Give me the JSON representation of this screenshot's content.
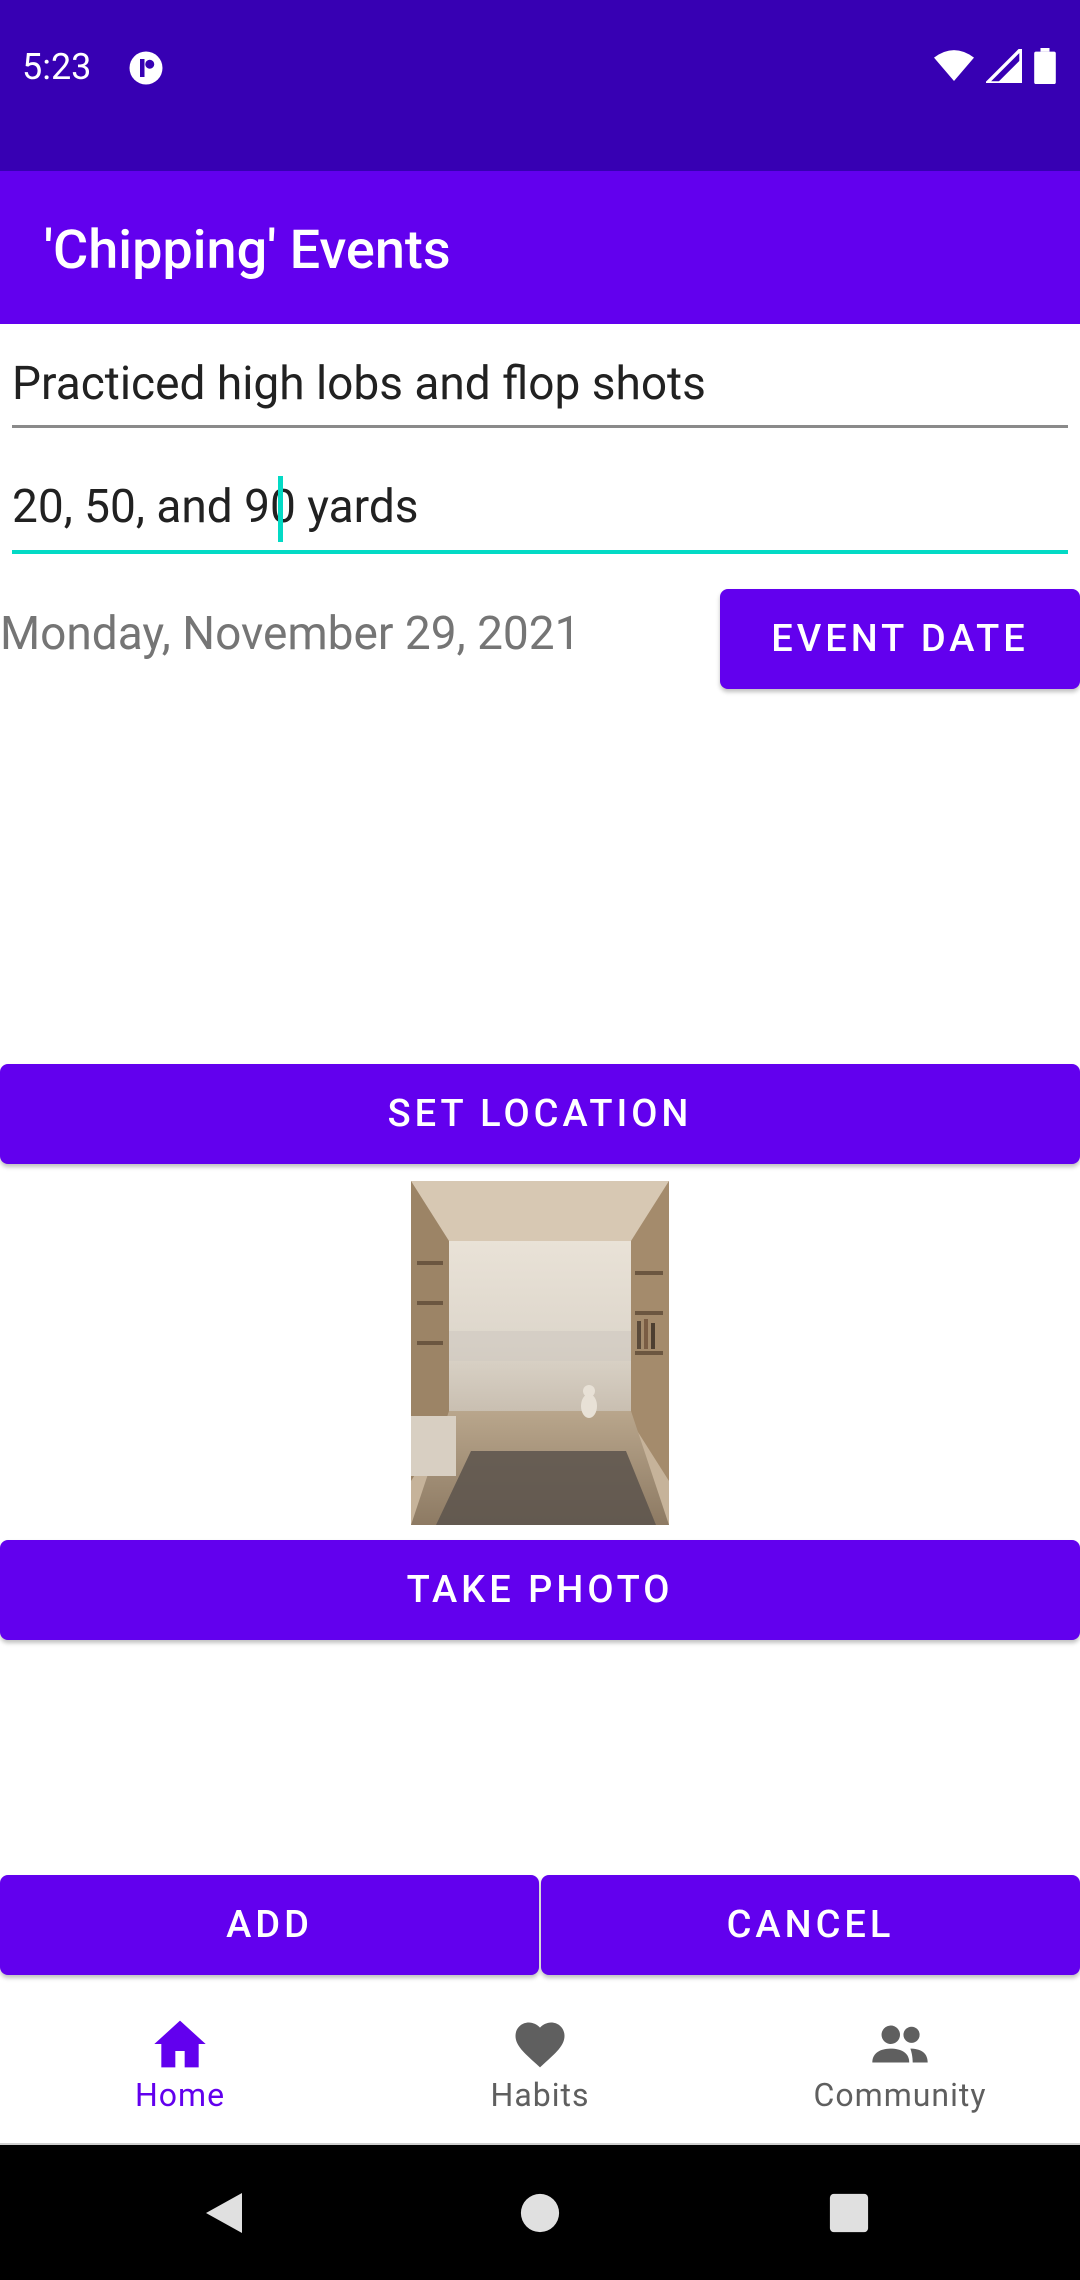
{
  "status_bar": {
    "time": "5:23"
  },
  "app_bar": {
    "title": "'Chipping' Events"
  },
  "form": {
    "description": "Practiced high lobs and flop shots",
    "details": "20, 50, and 90 yards",
    "date_text": "Monday, November 29, 2021"
  },
  "buttons": {
    "event_date": "EVENT DATE",
    "set_location": "SET LOCATION",
    "take_photo": "TAKE PHOTO",
    "add": "ADD",
    "cancel": "CANCEL"
  },
  "bottom_nav": {
    "items": [
      {
        "label": "Home",
        "icon": "home-icon",
        "selected": true
      },
      {
        "label": "Habits",
        "icon": "heart-icon",
        "selected": false
      },
      {
        "label": "Community",
        "icon": "people-icon",
        "selected": false
      }
    ]
  },
  "colors": {
    "status_bar": "#3700B3",
    "primary": "#6200EE",
    "accent": "#03DAC5"
  }
}
